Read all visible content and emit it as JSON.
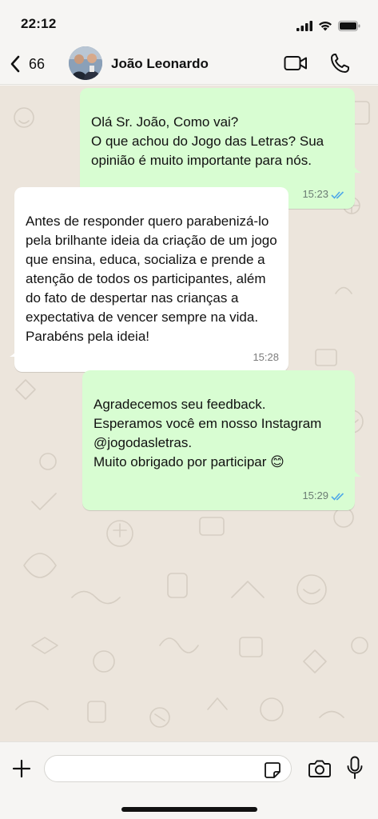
{
  "status_bar": {
    "time": "22:12"
  },
  "header": {
    "back_count": "66",
    "contact_name": "João Leonardo"
  },
  "messages": [
    {
      "direction": "outgoing",
      "text": "Olá Sr. João, Como vai?\nO que achou do Jogo das Letras? Sua opinião é muito importante para nós.",
      "time": "15:23",
      "read": true
    },
    {
      "direction": "incoming",
      "text": "Antes de responder quero parabenizá-lo pela brilhante ideia da criação de um jogo  que ensina, educa, socializa e prende a atenção de todos os participantes, além do fato de despertar nas crianças a expectativa de vencer sempre na vida. Parabéns pela ideia!",
      "time": "15:28"
    },
    {
      "direction": "outgoing",
      "text": "Agradecemos seu feedback.\nEsperamos você em nosso Instagram @jogodasletras.\nMuito obrigado por participar 😊",
      "time": "15:29",
      "read": true
    }
  ],
  "input": {
    "value": "",
    "placeholder": ""
  },
  "colors": {
    "outgoing_bubble": "#d8fdd2",
    "incoming_bubble": "#ffffff",
    "read_ticks": "#4fa8e8",
    "wallpaper": "#ece5dc"
  },
  "icons": [
    "back-chevron-icon",
    "video-camera-icon",
    "phone-icon",
    "plus-icon",
    "sticker-icon",
    "camera-icon",
    "microphone-icon",
    "signal-icon",
    "wifi-icon",
    "battery-icon"
  ]
}
